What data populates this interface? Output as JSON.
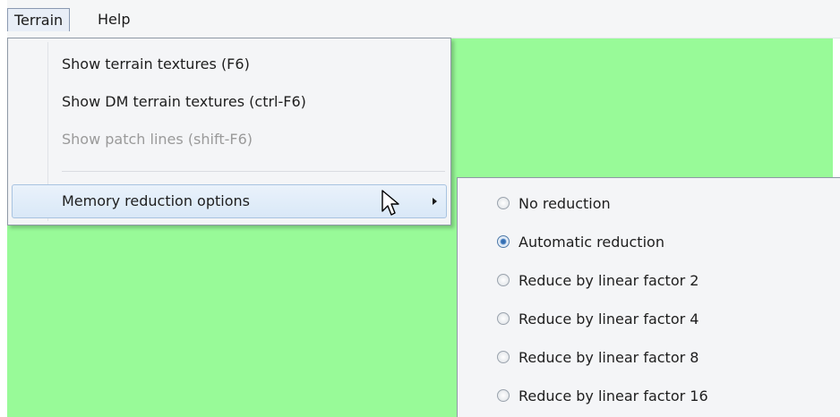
{
  "menubar": {
    "items": [
      {
        "label": "Terrain",
        "open": true
      },
      {
        "label": "Help",
        "open": false
      }
    ]
  },
  "terrain_menu": {
    "items": [
      {
        "label": "Show terrain textures (F6)",
        "enabled": true
      },
      {
        "label": "Show DM terrain textures (ctrl-F6)",
        "enabled": true
      },
      {
        "label": "Show patch lines (shift-F6)",
        "enabled": false
      },
      {
        "label": "Memory reduction options",
        "enabled": true,
        "has_submenu": true,
        "highlighted": true
      }
    ]
  },
  "memory_submenu": {
    "options": [
      {
        "label": "No reduction",
        "selected": false
      },
      {
        "label": "Automatic reduction",
        "selected": true
      },
      {
        "label": "Reduce by linear factor 2",
        "selected": false
      },
      {
        "label": "Reduce by linear factor 4",
        "selected": false
      },
      {
        "label": "Reduce by linear factor 8",
        "selected": false
      },
      {
        "label": "Reduce by linear factor 16",
        "selected": false
      }
    ]
  },
  "colors": {
    "viewport_background": "#98fa98",
    "menu_background": "#f4f5f7",
    "highlight": "#d9e8f7"
  }
}
